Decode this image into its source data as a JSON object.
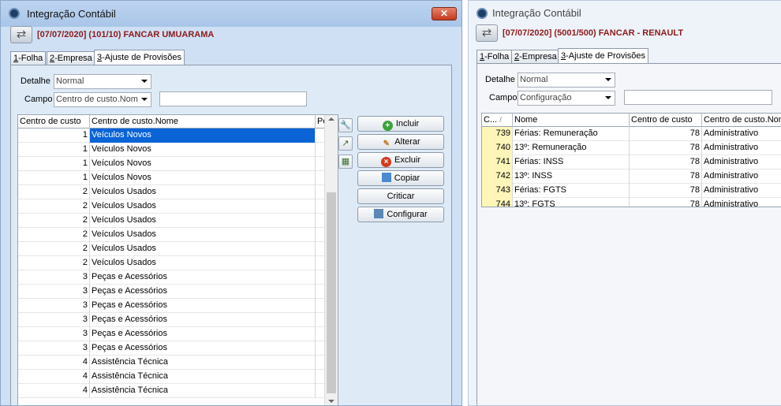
{
  "left": {
    "title": "Integração Contábil",
    "close": "✕",
    "header": "[07/07/2020] (101/10) FANCAR UMUARAMA",
    "tabs": [
      {
        "key": "1",
        "rest": "-Folha"
      },
      {
        "key": "2",
        "rest": "-Empresa"
      },
      {
        "key": "3",
        "rest": "-Ajuste de Provisões"
      }
    ],
    "detalhe_label": "Detalhe",
    "detalhe_value": "Normal",
    "campo_label": "Campo",
    "campo_value": "Centro de custo.Nom",
    "columns": [
      "Centro de custo",
      "Centro de custo.Nome",
      "Po"
    ],
    "rows": [
      {
        "code": "1",
        "name": "Veículos Novos",
        "selected": true
      },
      {
        "code": "1",
        "name": "Veículos Novos"
      },
      {
        "code": "1",
        "name": "Veículos Novos"
      },
      {
        "code": "1",
        "name": "Veículos Novos"
      },
      {
        "code": "2",
        "name": "Veículos Usados"
      },
      {
        "code": "2",
        "name": "Veículos Usados"
      },
      {
        "code": "2",
        "name": "Veículos Usados"
      },
      {
        "code": "2",
        "name": "Veículos Usados"
      },
      {
        "code": "2",
        "name": "Veículos Usados"
      },
      {
        "code": "2",
        "name": "Veículos Usados"
      },
      {
        "code": "3",
        "name": "Peças e Acessórios"
      },
      {
        "code": "3",
        "name": "Peças e Acessórios"
      },
      {
        "code": "3",
        "name": "Peças e Acessórios"
      },
      {
        "code": "3",
        "name": "Peças e Acessórios"
      },
      {
        "code": "3",
        "name": "Peças e Acessórios"
      },
      {
        "code": "3",
        "name": "Peças e Acessórios"
      },
      {
        "code": "4",
        "name": "Assistência Técnica"
      },
      {
        "code": "4",
        "name": "Assistência Técnica"
      },
      {
        "code": "4",
        "name": "Assistência Técnica"
      }
    ],
    "buttons": {
      "incluir": "Incluir",
      "alterar": "Alterar",
      "excluir": "Excluir",
      "copiar": "Copiar",
      "criticar": "Criticar",
      "configurar": "Configurar"
    }
  },
  "right": {
    "title": "Integração Contábil",
    "header": "[07/07/2020] (5001/500) FANCAR - RENAULT",
    "tabs": [
      {
        "key": "1",
        "rest": "-Folha"
      },
      {
        "key": "2",
        "rest": "-Empresa"
      },
      {
        "key": "3",
        "rest": "-Ajuste de Provisões"
      }
    ],
    "detalhe_label": "Detalhe",
    "detalhe_value": "Normal",
    "campo_label": "Campo",
    "campo_value": "Configuração",
    "columns": [
      "C...",
      "Nome",
      "Centro de custo",
      "Centro de custo.Nom"
    ],
    "sort_mark": "/",
    "rows": [
      {
        "code": "739",
        "name": "Férias: Remuneração",
        "cc": "78",
        "ccname": "Administrativo"
      },
      {
        "code": "740",
        "name": "13º: Remuneração",
        "cc": "78",
        "ccname": "Administrativo"
      },
      {
        "code": "741",
        "name": "Férias: INSS",
        "cc": "78",
        "ccname": "Administrativo"
      },
      {
        "code": "742",
        "name": "13º: INSS",
        "cc": "78",
        "ccname": "Administrativo"
      },
      {
        "code": "743",
        "name": "Férias: FGTS",
        "cc": "78",
        "ccname": "Administrativo"
      },
      {
        "code": "744",
        "name": "13º: FGTS",
        "cc": "78",
        "ccname": "Administrativo"
      }
    ]
  }
}
